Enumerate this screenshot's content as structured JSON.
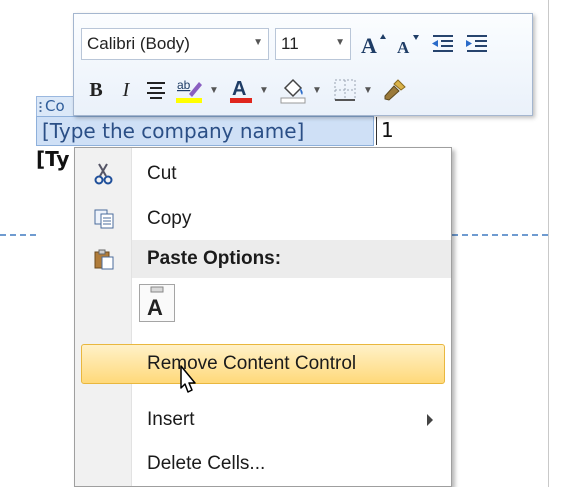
{
  "document": {
    "control_tab_label": "Co",
    "field_placeholder": "[Type the company name]",
    "trailing_text": "1",
    "next_line": "[Ty"
  },
  "mini_toolbar": {
    "font_name": "Calibri (Body)",
    "font_size": "11",
    "buttons_row1": [
      "grow-font-icon",
      "shrink-font-icon",
      "decrease-indent-icon",
      "increase-indent-icon"
    ],
    "bold_label": "B",
    "italic_label": "I",
    "font_color_label": "A",
    "highlight_label": "ab",
    "highlight_color": "#ffff00",
    "font_color": "#e0261d"
  },
  "context_menu": {
    "items": [
      {
        "label": "Cut",
        "icon": "scissors-icon"
      },
      {
        "label": "Copy",
        "icon": "copy-icon"
      },
      {
        "label": "Paste Options:",
        "icon": "clipboard-icon"
      },
      {
        "label": "Remove Content Control",
        "icon": ""
      },
      {
        "label": "Insert",
        "icon": ""
      },
      {
        "label": "Delete Cells...",
        "icon": ""
      }
    ],
    "paste_option_label": "A",
    "highlighted_item": "Remove Content Control"
  },
  "colors": {
    "accent_blue": "#6f9bd0",
    "menu_highlight": "#ffd97a"
  }
}
